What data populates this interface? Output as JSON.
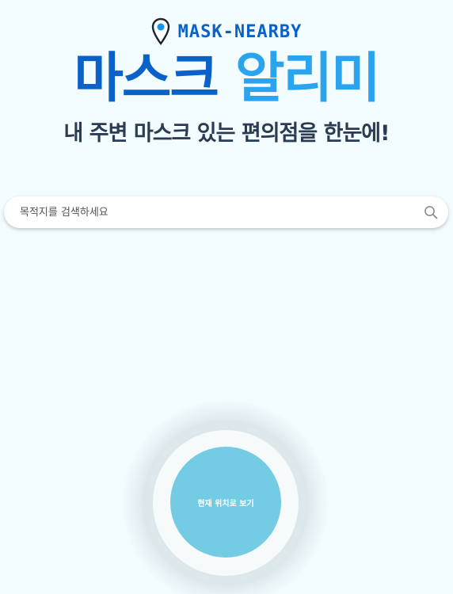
{
  "header": {
    "brand": "MASK-NEARBY",
    "brand_icon": "location-pin-icon",
    "title_part1": "마스크",
    "title_part2": "알리미",
    "subtitle": "내 주변 마스크 있는 편의점을 한눈에!"
  },
  "search": {
    "placeholder": "목적지를 검색하세요",
    "value": "",
    "icon": "search-icon"
  },
  "locate": {
    "label": "현재 위치로 보기"
  },
  "colors": {
    "background": "#f3fcfe",
    "brand_blue": "#0a62c8",
    "accent_blue": "#2aa4ee",
    "subtitle": "#2b3b54",
    "locate_button": "#74cbe4"
  }
}
